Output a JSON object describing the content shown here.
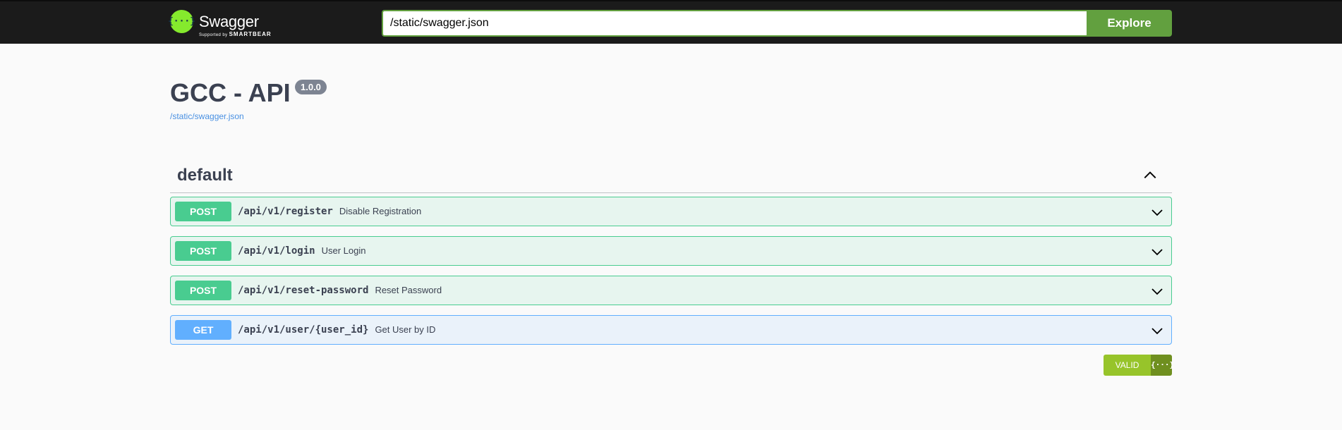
{
  "topbar": {
    "logo_glyph": "{···}",
    "brand": "Swagger",
    "supported_by": "Supported by",
    "company": "SMARTBEAR",
    "url_value": "/static/swagger.json",
    "explore_label": "Explore",
    "accent_color": "#62a03f"
  },
  "info": {
    "title": "GCC - API",
    "version": "1.0.0",
    "spec_url": "/static/swagger.json"
  },
  "tag": {
    "name": "default",
    "expanded": true,
    "toggle_icon": "chevron-up-icon"
  },
  "operations": [
    {
      "method": "POST",
      "path": "/api/v1/register",
      "summary": "Disable Registration"
    },
    {
      "method": "POST",
      "path": "/api/v1/login",
      "summary": "User Login"
    },
    {
      "method": "POST",
      "path": "/api/v1/reset-password",
      "summary": "Reset Password"
    },
    {
      "method": "GET",
      "path": "/api/v1/user/{user_id}",
      "summary": "Get User by ID"
    }
  ],
  "colors": {
    "post": "#49cc90",
    "get": "#61affe",
    "topbar_bg": "#1b1b1b"
  },
  "validator": {
    "label": "VALID",
    "icon_glyph": "{···}"
  }
}
